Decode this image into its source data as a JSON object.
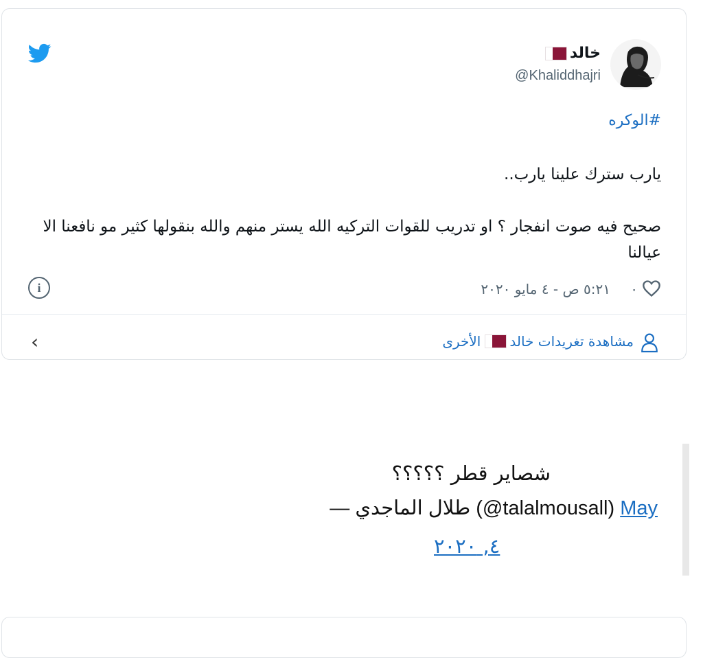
{
  "tweet": {
    "display_name": "خالد",
    "handle": "@Khaliddhajri",
    "hashtag": "#الوكره",
    "line1": "يارب سترك علينا يارب..",
    "line2": "صحيح فيه صوت انفجار ؟ او تدريب للقوات التركيه الله يستر منهم والله بنقولها كثير مو نافعنا الا عيالنا",
    "like_count": "٠",
    "timestamp": "٥:٢١ ص - ٤ مايو ٢٠٢٠",
    "view_more_prefix": "مشاهدة تغريدات خالد",
    "view_more_suffix": "الأخرى"
  },
  "quote": {
    "text": "شصاير قطر ؟؟؟؟؟",
    "author": "— طلال الماجدي (@talalmousall)",
    "month_link": "May",
    "date_link": "٤, ٢٠٢٠"
  },
  "colors": {
    "link": "#1b6ec2",
    "twitter": "#1d9bf0",
    "flag": "#8a1538"
  },
  "icons": [
    "twitter-logo-icon",
    "info-icon",
    "heart-icon",
    "person-icon",
    "chevron-left-icon"
  ]
}
